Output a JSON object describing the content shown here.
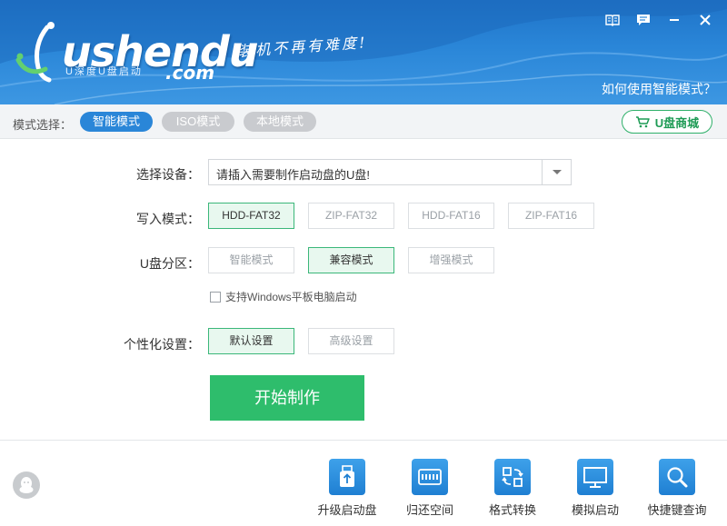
{
  "header": {
    "brand": "ushendu",
    "brand_suffix": ".com",
    "brand_sub": "U深度U盘启动",
    "slogan": "装机不再有难度!",
    "help_link": "如何使用智能模式？"
  },
  "mode_bar": {
    "label": "模式选择：",
    "modes": [
      "智能模式",
      "ISO模式",
      "本地模式"
    ],
    "active_mode": "智能模式",
    "shop_label": "U盘商城"
  },
  "form": {
    "device_label": "选择设备：",
    "device_value": "请插入需要制作启动盘的U盘!",
    "write_mode_label": "写入模式：",
    "write_modes": [
      "HDD-FAT32",
      "ZIP-FAT32",
      "HDD-FAT16",
      "ZIP-FAT16"
    ],
    "write_mode_selected": "HDD-FAT32",
    "partition_label": "U盘分区：",
    "partitions": [
      "智能模式",
      "兼容模式",
      "增强模式"
    ],
    "partition_selected": "兼容模式",
    "tablet_checkbox_label": "支持Windows平板电脑启动",
    "tablet_checked": false,
    "personal_label": "个性化设置：",
    "personal_options": [
      "默认设置",
      "高级设置"
    ],
    "personal_selected": "默认设置",
    "start_button": "开始制作"
  },
  "toolbar": {
    "tools": [
      {
        "label": "升级启动盘",
        "icon": "usb-upgrade-icon"
      },
      {
        "label": "归还空间",
        "icon": "storage-restore-icon"
      },
      {
        "label": "格式转换",
        "icon": "format-convert-icon"
      },
      {
        "label": "模拟启动",
        "icon": "monitor-icon"
      },
      {
        "label": "快捷键查询",
        "icon": "search-icon"
      }
    ]
  },
  "colors": {
    "header_blue": "#2a86d8",
    "accent_green": "#2ebd6c",
    "selected_green_bg": "#e8f8ef",
    "pill_inactive": "#c9cbcf"
  }
}
